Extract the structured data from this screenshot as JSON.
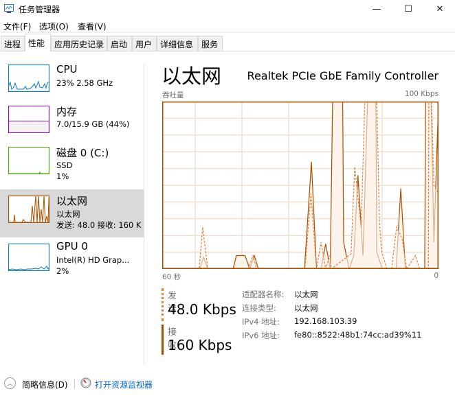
{
  "window": {
    "title": "任务管理器",
    "controls": {
      "minimize": "—",
      "maximize": "☐",
      "close": "✕"
    }
  },
  "menu": [
    "文件(F)",
    "选项(O)",
    "查看(V)"
  ],
  "tabs": [
    {
      "label": "进程",
      "active": false
    },
    {
      "label": "性能",
      "active": true
    },
    {
      "label": "应用历史记录",
      "active": false
    },
    {
      "label": "启动",
      "active": false
    },
    {
      "label": "用户",
      "active": false
    },
    {
      "label": "详细信息",
      "active": false
    },
    {
      "label": "服务",
      "active": false
    }
  ],
  "sidebar": {
    "items": [
      {
        "title": "CPU",
        "line1": "23% 2.58 GHz",
        "line2": "",
        "color": "#117dbb",
        "fill": "#f1f6fa"
      },
      {
        "title": "内存",
        "line1": "7.0/15.9 GB (44%)",
        "line2": "",
        "color": "#8b12ae",
        "fill": "#f4f2f4",
        "level": 0.44
      },
      {
        "title": "磁盘 0 (C:)",
        "line1": "SSD",
        "line2": "1%",
        "color": "#4da60c",
        "fill": "#eff7e7"
      },
      {
        "title": "以太网",
        "line1": "以太网",
        "line2": "发送: 48.0 接收: 160 K",
        "color": "#a74f01",
        "fill": "#fcf3eb",
        "selected": true
      },
      {
        "title": "GPU 0",
        "line1": "Intel(R) HD Grap...",
        "line2": "2%",
        "color": "#117dbb",
        "fill": "#f1f6fa"
      }
    ]
  },
  "main": {
    "title": "以太网",
    "subtitle": "Realtek PCIe GbE Family Controller",
    "y_label": "吞吐量",
    "y_max_label": "100 Kbps",
    "x_left_label": "60 秒",
    "x_right_label": "0"
  },
  "stats": {
    "send": {
      "label": "发送",
      "value": "48.0 Kbps"
    },
    "receive": {
      "label": "接收",
      "value": "160 Kbps"
    }
  },
  "info": [
    {
      "key": "适配器名称:",
      "value": "以太网"
    },
    {
      "key": "连接类型:",
      "value": "以太网"
    },
    {
      "key": "IPv4 地址:",
      "value": "192.168.103.39"
    },
    {
      "key": "IPv6 地址:",
      "value": "fe80::8522:48b1:74cc:ad39%11"
    }
  ],
  "footer": {
    "brief": "简略信息(D)",
    "monitor": "打开资源监视器"
  },
  "colors": {
    "accent": "#a74f01",
    "send_line": "#e37e3f",
    "fill": "#fcf3eb",
    "grid": "#f0e0d0",
    "link": "#0066cc"
  },
  "chart_data": {
    "type": "area",
    "title": "吞吐量",
    "xlabel": "60 秒 → 0",
    "ylabel": "Kbps",
    "ylim": [
      0,
      100
    ],
    "xlim": [
      60,
      0
    ],
    "grid": true,
    "series": [
      {
        "name": "接收",
        "style": "solid",
        "points": [
          [
            60,
            0
          ],
          [
            52.8,
            0
          ],
          [
            51.9,
            0
          ],
          [
            51,
            7
          ],
          [
            50.1,
            0
          ],
          [
            44.6,
            0
          ],
          [
            43.9,
            8
          ],
          [
            42,
            8
          ],
          [
            41,
            0
          ],
          [
            40,
            8
          ],
          [
            39.1,
            0
          ],
          [
            30,
            0
          ],
          [
            29.1,
            0
          ],
          [
            27.6,
            64
          ],
          [
            26.5,
            0
          ],
          [
            25.5,
            0
          ],
          [
            24.5,
            15
          ],
          [
            23.5,
            0
          ],
          [
            23,
            100
          ],
          [
            20.8,
            100
          ],
          [
            20.6,
            16
          ],
          [
            19.4,
            0
          ],
          [
            18.4,
            8
          ],
          [
            17.5,
            56
          ],
          [
            16.4,
            8
          ],
          [
            15.4,
            100
          ],
          [
            13.6,
            100
          ],
          [
            13.4,
            10
          ],
          [
            12.2,
            0
          ],
          [
            10,
            0
          ],
          [
            9.2,
            0
          ],
          [
            8.2,
            48
          ],
          [
            7.2,
            0
          ],
          [
            3,
            0
          ],
          [
            2.8,
            100
          ],
          [
            1.6,
            100
          ],
          [
            1,
            16
          ],
          [
            0,
            100
          ]
        ]
      },
      {
        "name": "发送",
        "style": "dashed",
        "points": [
          [
            60,
            0
          ],
          [
            52.8,
            0
          ],
          [
            52,
            0
          ],
          [
            51.2,
            25
          ],
          [
            50.1,
            0
          ],
          [
            41.3,
            0
          ],
          [
            40.3,
            8
          ],
          [
            39.5,
            0
          ],
          [
            30,
            0
          ],
          [
            29,
            0
          ],
          [
            27.7,
            45
          ],
          [
            26.5,
            0
          ],
          [
            25.5,
            16
          ],
          [
            24.5,
            0
          ],
          [
            23.6,
            8
          ],
          [
            23.3,
            0
          ],
          [
            19,
            9
          ],
          [
            18.2,
            61
          ],
          [
            16.8,
            25
          ],
          [
            16,
            100
          ],
          [
            13.4,
            100
          ],
          [
            12.8,
            27
          ],
          [
            12.3,
            10
          ],
          [
            11.2,
            0
          ],
          [
            10.2,
            0
          ],
          [
            9.1,
            25
          ],
          [
            7.9,
            18
          ],
          [
            6.9,
            0
          ],
          [
            5,
            8
          ],
          [
            4.1,
            0
          ],
          [
            2.2,
            0
          ],
          [
            2.1,
            100
          ],
          [
            1.5,
            100
          ],
          [
            1,
            50
          ],
          [
            0,
            45
          ]
        ]
      }
    ]
  }
}
